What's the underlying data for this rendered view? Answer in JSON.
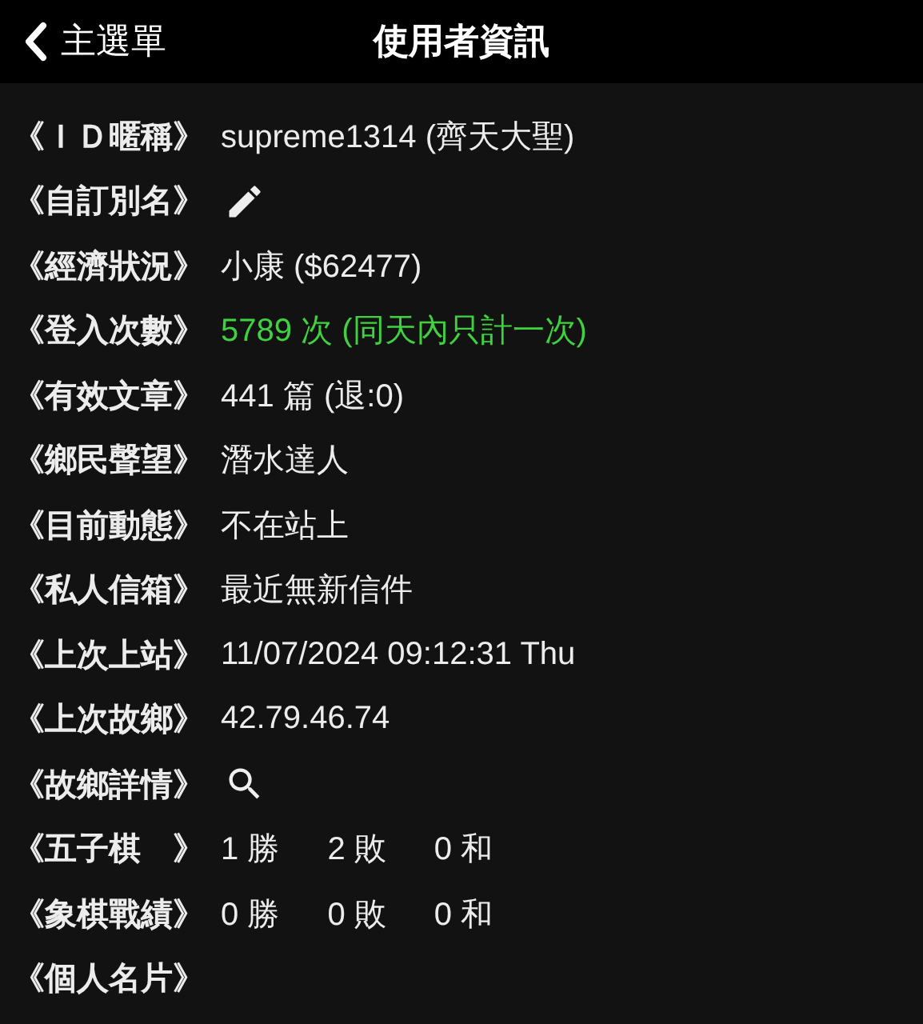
{
  "nav_bar": {
    "back_label": "主選單",
    "title": "使用者資訊"
  },
  "rows": [
    {
      "label": "《ＩＤ暱稱》",
      "kind": "text",
      "value": "supreme1314 (齊天大聖)"
    },
    {
      "label": "《自訂別名》",
      "kind": "edit"
    },
    {
      "label": "《經濟狀況》",
      "kind": "text",
      "value": "小康 ($62477)"
    },
    {
      "label": "《登入次數》",
      "kind": "highlight",
      "value": "5789 次 (同天內只計一次)"
    },
    {
      "label": "《有效文章》",
      "kind": "text",
      "value": "441 篇 (退:0)"
    },
    {
      "label": "《鄉民聲望》",
      "kind": "text",
      "value": "潛水達人"
    },
    {
      "label": "《目前動態》",
      "kind": "text",
      "value": "不在站上"
    },
    {
      "label": "《私人信箱》",
      "kind": "text",
      "value": "最近無新信件"
    },
    {
      "label": "《上次上站》",
      "kind": "text",
      "value": "11/07/2024 09:12:31 Thu"
    },
    {
      "label": "《上次故鄉》",
      "kind": "text",
      "value": "42.79.46.74"
    },
    {
      "label": "《故鄉詳情》",
      "kind": "search"
    },
    {
      "label": "《五子棋　》",
      "kind": "record",
      "results": [
        "1 勝",
        "2 敗",
        "0 和"
      ]
    },
    {
      "label": "《象棋戰績》",
      "kind": "record",
      "results": [
        "0 勝",
        "0 敗",
        "0 和"
      ]
    },
    {
      "label": "《個人名片》",
      "kind": "label_only"
    }
  ]
}
